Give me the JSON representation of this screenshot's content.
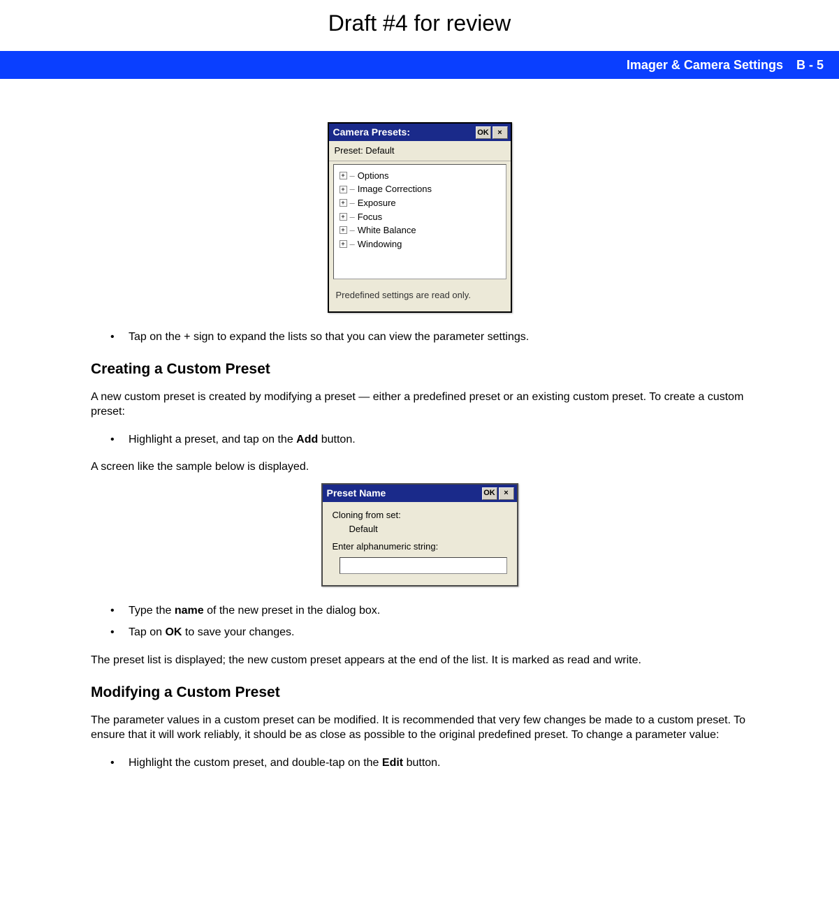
{
  "draft_title": "Draft #4 for review",
  "header": {
    "section": "Imager & Camera Settings",
    "page": "B - 5"
  },
  "dlg_presets": {
    "title": "Camera Presets:",
    "ok": "OK",
    "close": "×",
    "preset_label": "Preset: Default",
    "tree": [
      "Options",
      "Image Corrections",
      "Exposure",
      "Focus",
      "White Balance",
      "Windowing"
    ],
    "readonly": "Predefined settings are read only."
  },
  "bullets_after_fig1": [
    "Tap on the + sign to expand the lists so that you can view the parameter settings."
  ],
  "section_create": {
    "heading": "Creating a Custom Preset",
    "para1": "A new custom preset is created by modifying a preset — either a predefined preset or an existing custom preset. To create a custom preset:",
    "bullet_pre": "Highlight a preset, and tap on the ",
    "bullet_bold": "Add",
    "bullet_post": " button.",
    "para2": "A screen like the sample below is displayed."
  },
  "dlg_name": {
    "title": "Preset Name",
    "ok": "OK",
    "close": "×",
    "line1": "Cloning from set:",
    "line1_value": "Default",
    "label2": "Enter alphanumeric string:"
  },
  "bullets_after_fig2": {
    "b1_pre": "Type the ",
    "b1_bold": "name",
    "b1_post": " of the new preset in the dialog box.",
    "b2_pre": "Tap on ",
    "b2_bold": "OK",
    "b2_post": " to save your changes."
  },
  "para_after_list": "The preset list is displayed; the new custom preset appears at the end of the list. It is marked as read and write.",
  "section_modify": {
    "heading": "Modifying a Custom Preset",
    "para": "The parameter values in a custom preset can be modified. It is recommended that very few changes be made to a custom preset. To ensure that it will work reliably, it should be as close as possible to the original predefined preset. To change a parameter value:",
    "bullet_pre": "Highlight the custom preset, and double-tap on the ",
    "bullet_bold": "Edit",
    "bullet_post": " button."
  }
}
